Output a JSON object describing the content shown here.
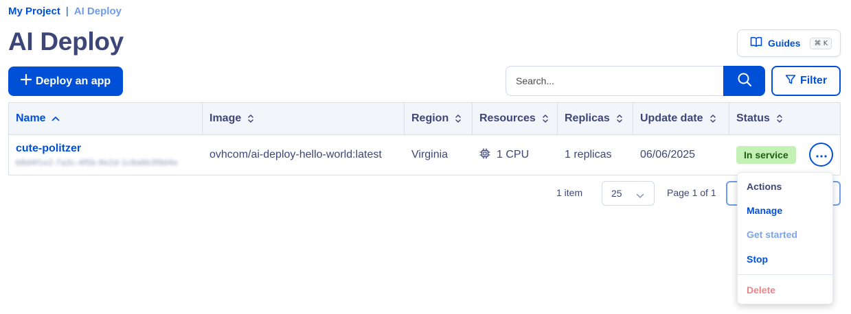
{
  "breadcrumb": {
    "root": "My Project",
    "separator": "|",
    "current": "AI Deploy"
  },
  "page": {
    "title": "AI Deploy"
  },
  "guides": {
    "label": "Guides",
    "shortcut": "⌘ K",
    "icon": "book-icon"
  },
  "toolbar": {
    "deploy_label": "Deploy an app",
    "search_placeholder": "Search...",
    "search_icon": "search-icon",
    "filter_label": "Filter",
    "filter_icon": "filter-icon"
  },
  "table": {
    "columns": [
      {
        "label": "Name",
        "sort": "asc"
      },
      {
        "label": "Image",
        "sort": "none"
      },
      {
        "label": "Region",
        "sort": "none"
      },
      {
        "label": "Resources",
        "sort": "none"
      },
      {
        "label": "Replicas",
        "sort": "none"
      },
      {
        "label": "Update date",
        "sort": "none"
      },
      {
        "label": "Status",
        "sort": "none"
      }
    ],
    "rows": [
      {
        "name": "cute-politzer",
        "id": "b8d4f1e2-7a3c-4f5b-9e2d-1c8a6b3f9d4e",
        "image": "ovhcom/ai-deploy-hello-world:latest",
        "region": "Virginia",
        "resources": "1 CPU",
        "replicas": "1 replicas",
        "update_date": "06/06/2025",
        "status": "In service"
      }
    ]
  },
  "pagination": {
    "item_count": "1 item",
    "page_size": "25",
    "page_info": "Page 1 of 1"
  },
  "row_menu": {
    "header": "Actions",
    "items": [
      "Manage",
      "Get started",
      "Stop",
      "Delete"
    ]
  },
  "colors": {
    "primary": "#0050d7",
    "heading": "#3d4678",
    "status_bg": "#c3f0b5",
    "danger_text": "#e8858b"
  }
}
